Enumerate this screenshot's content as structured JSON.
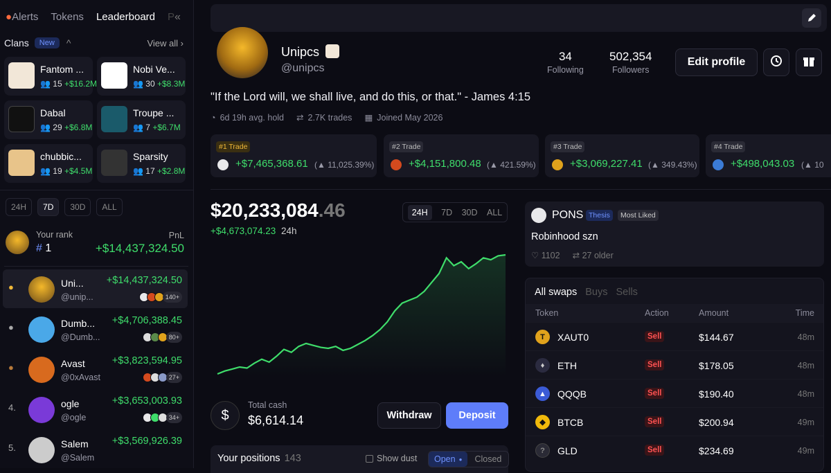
{
  "sidebar": {
    "tabs": [
      "Alerts",
      "Tokens",
      "Leaderboard",
      "P"
    ],
    "clans_title": "Clans",
    "clans_badge": "New",
    "view_all": "View all",
    "clans": [
      {
        "name": "Fantom ...",
        "members": "15",
        "pnl": "+$16.2M"
      },
      {
        "name": "Nobi Ve...",
        "members": "30",
        "pnl": "+$8.3M"
      },
      {
        "name": "Dabal",
        "members": "29",
        "pnl": "+$6.8M"
      },
      {
        "name": "Troupe ...",
        "members": "7",
        "pnl": "+$6.7M"
      },
      {
        "name": "chubbic...",
        "members": "19",
        "pnl": "+$4.5M"
      },
      {
        "name": "Sparsity",
        "members": "17",
        "pnl": "+$2.8M"
      }
    ],
    "ranges": [
      "24H",
      "7D",
      "30D",
      "ALL"
    ],
    "your_rank_label": "Your rank",
    "your_rank_value": "1",
    "pnl_label": "PnL",
    "your_pnl": "+$14,437,324.50",
    "leaderboard": [
      {
        "rank": "1",
        "name": "Uni...",
        "handle": "@unip...",
        "pnl": "+$14,437,324.50",
        "more": "140+"
      },
      {
        "rank": "2",
        "name": "Dumb...",
        "handle": "@Dumb...",
        "pnl": "+$4,706,388.45",
        "more": "80+"
      },
      {
        "rank": "3",
        "name": "Avast",
        "handle": "@0xAvast",
        "pnl": "+$3,823,594.95",
        "more": "27+"
      },
      {
        "rank": "4.",
        "name": "ogle",
        "handle": "@ogle",
        "pnl": "+$3,653,003.93",
        "more": "34+"
      },
      {
        "rank": "5.",
        "name": "Salem",
        "handle": "@Salem",
        "pnl": "+$3,569,926.39",
        "more": ""
      }
    ]
  },
  "profile": {
    "name": "Unipcs",
    "handle": "@unipcs",
    "following": "34",
    "following_label": "Following",
    "followers": "502,354",
    "followers_label": "Followers",
    "edit_label": "Edit profile",
    "bio": "\"If the Lord will, we shall live, and do this, or that.\" - James 4:15",
    "avg_hold": "6d 19h avg. hold",
    "trades": "2.7K trades",
    "joined": "Joined May 2026"
  },
  "top_trades": [
    {
      "label": "#1 Trade",
      "amount": "+$7,465,368.61",
      "pct": "11,025.39%"
    },
    {
      "label": "#2 Trade",
      "amount": "+$4,151,800.48",
      "pct": "421.59%"
    },
    {
      "label": "#3 Trade",
      "amount": "+$3,069,227.41",
      "pct": "349.43%"
    },
    {
      "label": "#4 Trade",
      "amount": "+$498,043.03",
      "pct": "10"
    }
  ],
  "balance": {
    "main": "$20,233,084",
    "decimals": ".46",
    "change": "+$4,673,074.23",
    "change_period": "24h",
    "ranges": [
      "24H",
      "7D",
      "30D",
      "ALL"
    ],
    "cash_label": "Total cash",
    "cash_value": "$6,614.14",
    "withdraw": "Withdraw",
    "deposit": "Deposit"
  },
  "chart_data": {
    "type": "line",
    "x": [
      0,
      1,
      2,
      3,
      4,
      5,
      6,
      7,
      8,
      9,
      10,
      11,
      12,
      13,
      14,
      15,
      16,
      17,
      18,
      19,
      20,
      21,
      22,
      23,
      24,
      25,
      26,
      27,
      28,
      29,
      30,
      31,
      32,
      33,
      34,
      35,
      36,
      37,
      38,
      39
    ],
    "values": [
      2,
      5,
      7,
      9,
      8,
      13,
      17,
      14,
      20,
      27,
      24,
      30,
      33,
      31,
      29,
      28,
      30,
      26,
      28,
      32,
      36,
      41,
      47,
      55,
      66,
      74,
      77,
      80,
      86,
      95,
      104,
      120,
      112,
      116,
      109,
      114,
      120,
      118,
      122,
      123
    ],
    "title": "",
    "xlabel": "",
    "ylabel": "",
    "color": "#3fdd6b"
  },
  "positions": {
    "title": "Your positions",
    "count": "143",
    "dust_label": "Show dust",
    "open_label": "Open",
    "closed_label": "Closed"
  },
  "thesis": {
    "token": "PONS",
    "tag1": "Thesis",
    "tag2": "Most Liked",
    "text": "Robinhood szn",
    "likes": "1102",
    "older": "27 older"
  },
  "swaps": {
    "tabs": [
      "All swaps",
      "Buys",
      "Sells"
    ],
    "columns": [
      "Token",
      "Action",
      "Amount",
      "Time"
    ],
    "rows": [
      {
        "token": "XAUT0",
        "action": "Sell",
        "amount": "$144.67",
        "time": "48m",
        "color": "#e0a21c"
      },
      {
        "token": "ETH",
        "action": "Sell",
        "amount": "$178.05",
        "time": "48m",
        "color": "#2b2b40"
      },
      {
        "token": "QQQB",
        "action": "Sell",
        "amount": "$190.40",
        "time": "48m",
        "color": "#3b5bd6"
      },
      {
        "token": "BTCB",
        "action": "Sell",
        "amount": "$200.94",
        "time": "49m",
        "color": "#f0b90b"
      },
      {
        "token": "GLD",
        "action": "Sell",
        "amount": "$234.69",
        "time": "49m",
        "color": "#2a2a35"
      }
    ]
  }
}
